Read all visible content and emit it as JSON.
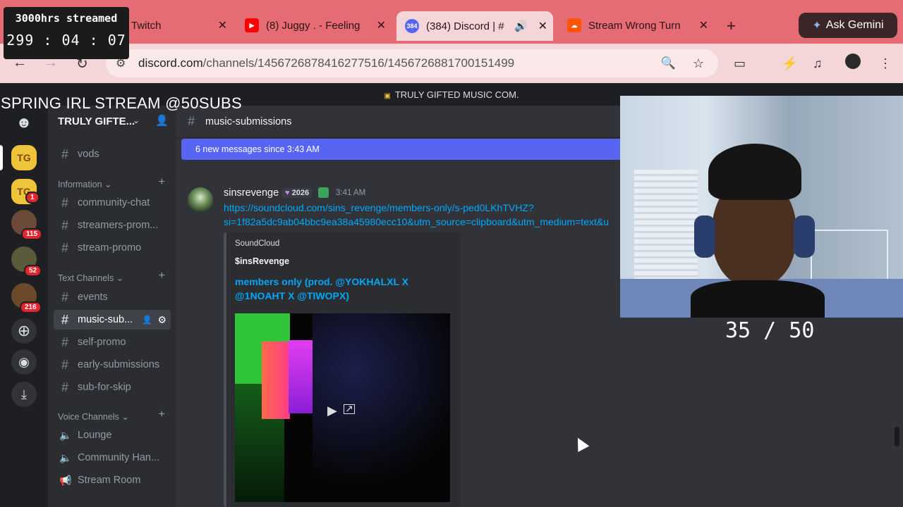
{
  "overlay": {
    "streamed_title": "3000hrs streamed",
    "timer": {
      "hours": "299",
      "minutes": "04",
      "seconds": "07"
    },
    "stream_title": "SPRING IRL STREAM @50SUBS",
    "sub_counter": "35 / 50"
  },
  "browser": {
    "tabs": [
      {
        "label": "Twitch",
        "icon": "twitch-icon"
      },
      {
        "label": "(8) Juggy . - Feeling",
        "icon": "youtube-icon"
      },
      {
        "label": "(384) Discord | #",
        "icon": "discord-icon",
        "active": true
      },
      {
        "label": "Stream Wrong Turn",
        "icon": "soundcloud-icon"
      }
    ],
    "favicon_badge": "384",
    "ask_gemini": "Ask Gemini",
    "url_host": "discord.com",
    "url_path": "/channels/1456726878416277516/1456726881700151499"
  },
  "discord": {
    "top_bar": "TRULY GIFTED MUSIC COM.",
    "server_name": "TRULY GIFTE...",
    "guild_badges": [
      "1",
      "115",
      "52",
      "216"
    ],
    "guild_tg": "TG",
    "channels": {
      "top": "vods",
      "information_label": "Information",
      "information": [
        "community-chat",
        "streamers-prom...",
        "stream-promo"
      ],
      "text_label": "Text Channels",
      "text": [
        "events",
        "music-sub...",
        "self-promo",
        "early-submissions",
        "sub-for-skip"
      ],
      "voice_label": "Voice Channels",
      "voice": [
        "Lounge",
        "Community Han...",
        "Stream Room"
      ]
    },
    "channel_header": "music-submissions",
    "new_messages": "6 new messages since 3:43 AM",
    "message": {
      "author": "sinsrevenge",
      "tag": "2026",
      "time": "3:41 AM",
      "link_line1": "https://soundcloud.com/sins_revenge/members-only/s-ped0LKhTVHZ?",
      "link_line2": "si=1f82a5dc9ab04bbc9ea38a45980ecc10&utm_source=clipboard&utm_medium=text&u",
      "embed_provider": "SoundCloud",
      "embed_author": "$insRevenge",
      "embed_title": "members only (prod. @YOKHALXL X @1NOAHT X @TIWOPX)"
    }
  }
}
